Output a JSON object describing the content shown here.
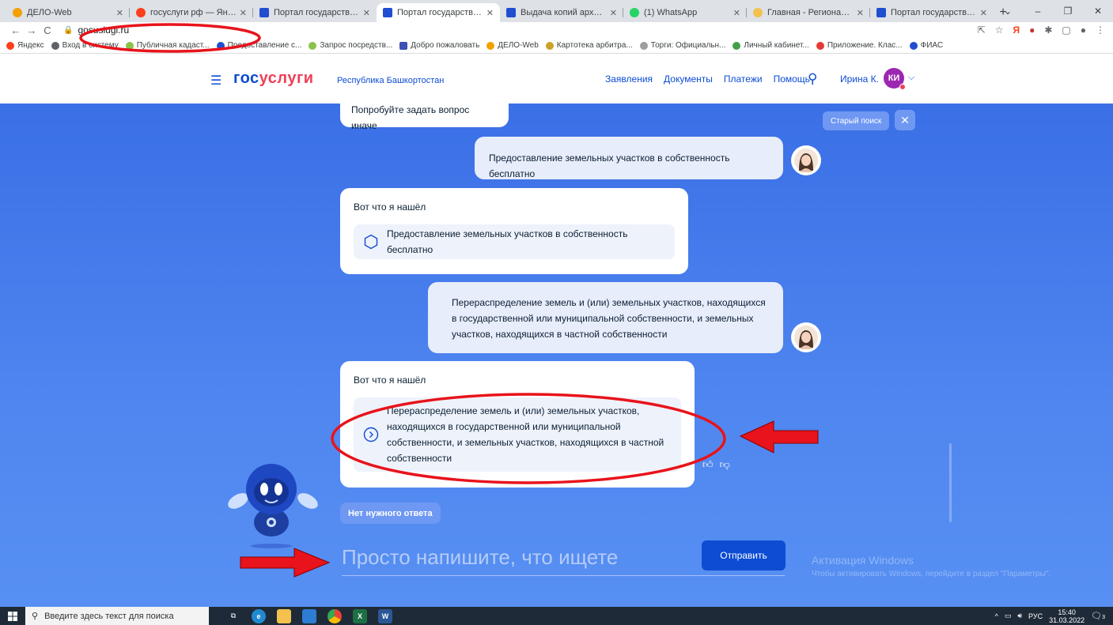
{
  "browser": {
    "tabs": [
      {
        "title": "ДЕЛО-Web",
        "color": "#f2a100"
      },
      {
        "title": "госуслуги рф — Яндекс: н",
        "color": "#fc3f1d"
      },
      {
        "title": "Портал государственных",
        "color": "#1f4ecf"
      },
      {
        "title": "Портал государственных",
        "color": "#1f4ecf",
        "active": true
      },
      {
        "title": "Выдача копий архивных",
        "color": "#1f4ecf"
      },
      {
        "title": "(1) WhatsApp",
        "color": "#25d366"
      },
      {
        "title": "Главная - Региональный",
        "color": "#f2c14e"
      },
      {
        "title": "Портал государственных",
        "color": "#1f4ecf"
      }
    ],
    "new_tab": "+",
    "window_controls": {
      "min": "–",
      "restore": "❐",
      "close": "✕",
      "tabsearch": "⌄"
    },
    "url": "gosuslugi.ru",
    "toolbar_icons": [
      "share",
      "star",
      "yandex",
      "extension-cookie",
      "puzzle",
      "sidebar",
      "profile",
      "menu"
    ],
    "bookmarks": [
      {
        "label": "Яндекс",
        "color": "#fc3f1d"
      },
      {
        "label": "Вход в систему",
        "color": "#5f6368"
      },
      {
        "label": "Публичная кадаст...",
        "color": "#8bc34a"
      },
      {
        "label": "Предоставление с...",
        "color": "#1f4ecf"
      },
      {
        "label": "Запрос посредств...",
        "color": "#8bc34a"
      },
      {
        "label": "Добро пожаловать",
        "color": "#3f51b5"
      },
      {
        "label": "ДЕЛО-Web",
        "color": "#f2a100"
      },
      {
        "label": "Картотека арбитра...",
        "color": "#c9a227"
      },
      {
        "label": "Торги: Официальн...",
        "color": "#9e9e9e"
      },
      {
        "label": "Личный кабинет...",
        "color": "#43a047"
      },
      {
        "label": "Приложение. Клас...",
        "color": "#e53935"
      },
      {
        "label": "ФИАС",
        "color": "#1f4ecf"
      }
    ]
  },
  "site": {
    "logo_part1": "гос",
    "logo_part2": "услуги",
    "region": "Республика Башкортостан",
    "nav": [
      "Заявления",
      "Документы",
      "Платежи",
      "Помощь"
    ],
    "user_name": "Ирина К.",
    "user_initials": "КИ",
    "brand_blue": "#0d4cd3",
    "brand_red": "#ee3f58"
  },
  "chat": {
    "old_search": "Старый поиск",
    "messages": [
      {
        "from": "bot",
        "text": "Попробуйте задать вопрос иначе"
      },
      {
        "from": "user",
        "text": "Предоставление земельных участков в собственность бесплатно"
      },
      {
        "from": "bot",
        "lead": "Вот что я нашёл",
        "result": "Предоставление земельных участков в собственность бесплатно"
      },
      {
        "from": "user",
        "text": "Перераспределение земель и (или) земельных участков, находящихся в государственной или муниципальной собственности, и земельных участков, находящихся в частной собственности"
      },
      {
        "from": "bot",
        "lead": "Вот что я нашёл",
        "result": "Перераспределение земель и (или) земельных участков, находящихся в государственной или муниципальной собственности, и земельных участков, находящихся в частной собственности"
      }
    ],
    "no_answer": "Нет нужного ответа",
    "input_placeholder": "Просто напишите, что ищете",
    "send": "Отправить"
  },
  "watermark": {
    "line1": "Активация Windows",
    "line2": "Чтобы активировать Windows, перейдите в раздел \"Параметры\"."
  },
  "taskbar": {
    "search_placeholder": "Введите здесь текст для поиска",
    "apps": [
      "task-view",
      "edge",
      "file-explorer",
      "store",
      "chrome",
      "excel",
      "word"
    ],
    "lang": "РУС",
    "time": "15:40",
    "date": "31.03.2022",
    "notification_count": "3"
  }
}
